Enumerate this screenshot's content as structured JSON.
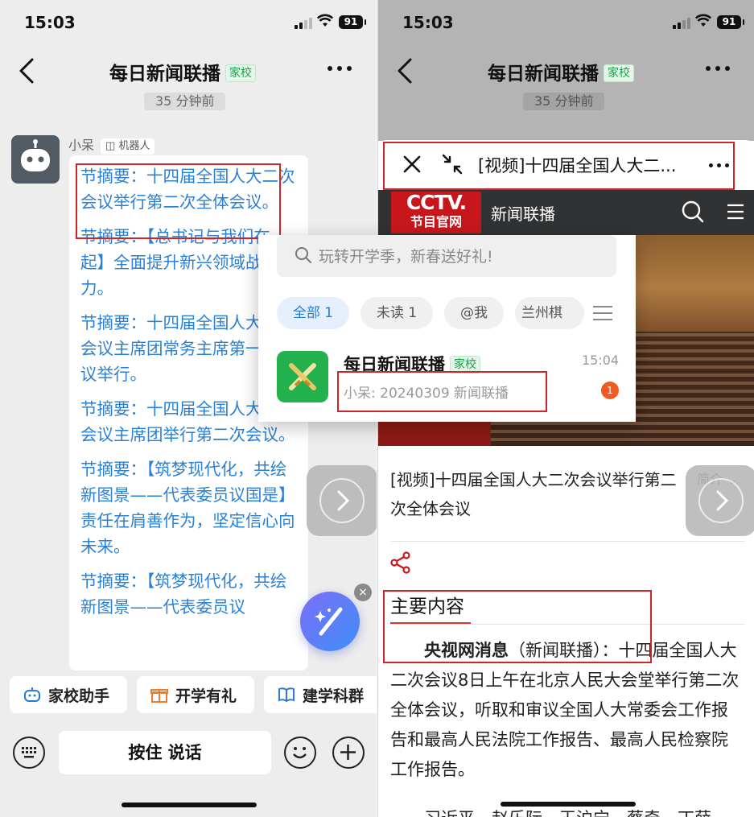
{
  "status": {
    "time": "15:03",
    "battery": "91"
  },
  "chat": {
    "title": "每日新闻联播",
    "tag": "家校",
    "timestamp": "35 分钟前",
    "sender": "小呆",
    "sender_tag": "机器人",
    "messages": [
      "节摘要：十四届全国人大二次会议举行第二次全体会议。",
      "节摘要：【总书记与我们在一起】全面提升新兴领域战略能力。",
      "节摘要：十四届全国人大二次会议主席团常务主席第一次会议举行。",
      "节摘要：十四届全国人大二次会议主席团举行第二次会议。",
      "节摘要：【筑梦现代化，共绘新图景——代表委员议国是】责任在肩善作为，坚定信心向未来。",
      "节摘要：【筑梦现代化，共绘新图景——代表委员议"
    ],
    "close_label": "×"
  },
  "quick_actions": [
    "家校助手",
    "开学有礼",
    "建学科群"
  ],
  "input": {
    "hold_to_talk": "按住 说话"
  },
  "popup": {
    "search_placeholder": "玩转开学季，新春送好礼!",
    "filters": [
      {
        "label": "全部 1",
        "active": true
      },
      {
        "label": "未读 1",
        "active": false
      },
      {
        "label": "@我",
        "active": false
      },
      {
        "label": "兰州棋",
        "active": false
      }
    ],
    "conversation": {
      "name": "每日新闻联播",
      "tag": "家校",
      "time": "15:04",
      "preview": "小呆: 20240309 新闻联播",
      "unread": "1"
    }
  },
  "web": {
    "title": "[视频]十四届全国人大二...",
    "cctv_logo_1": "CCTV.",
    "cctv_logo_2": "节目官网",
    "channel": "新闻联播",
    "video_title": "[视频]十四届全国人大二次会议举行第二次全体会议",
    "intro_label": "简介",
    "section_title": "主要内容",
    "article_lead": "央视网消息",
    "article_source": "（新闻联播）：",
    "article_body": "十四届全国人大二次会议8日上午在北京人民大会堂举行第二次全体会议，听取和审议全国人大常委会工作报告和最高人民法院工作报告、最高人民检察院工作报告。",
    "article_cut": "习近平、赵乐际、王沪宁、蔡奇、丁薛"
  },
  "colors": {
    "link_blue": "#2a80d6",
    "tag_green": "#1aa34a",
    "cctv_red": "#c8161d",
    "annotation_red": "#d0242b",
    "badge_orange": "#f05a23"
  }
}
